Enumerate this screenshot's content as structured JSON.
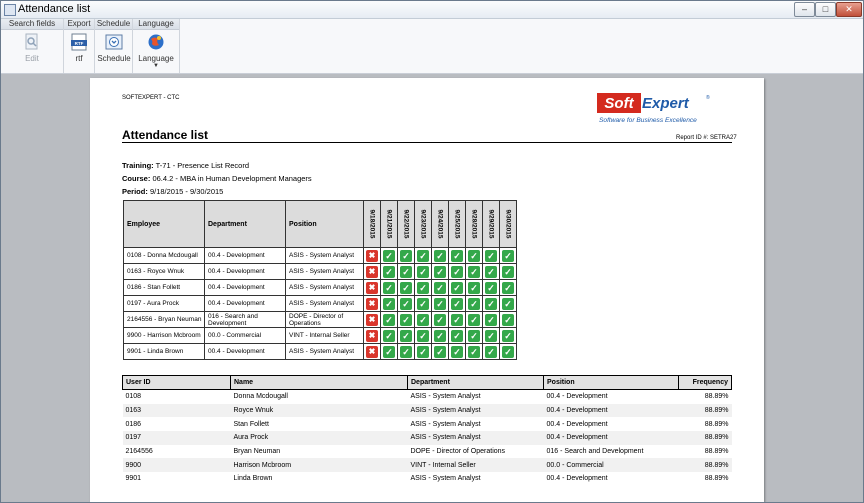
{
  "window": {
    "title": "Attendance list",
    "minimize": "–",
    "maximize": "□",
    "close": "✕"
  },
  "ribbon": {
    "groups": [
      {
        "name": "Search fields",
        "buttons": [
          {
            "label": "Edit",
            "icon": "magnifier-doc-icon",
            "disabled": true
          }
        ]
      },
      {
        "name": "Export",
        "buttons": [
          {
            "label": "rtf",
            "icon": "rtf-file-icon",
            "badge": "RTF"
          }
        ]
      },
      {
        "name": "Schedule",
        "buttons": [
          {
            "label": "Schedule",
            "icon": "schedule-icon"
          }
        ]
      },
      {
        "name": "Language",
        "buttons": [
          {
            "label": "Language",
            "icon": "globe-icon"
          }
        ]
      }
    ]
  },
  "report": {
    "company": "SOFTEXPERT - CTC",
    "logo": {
      "brand_left": "Soft",
      "brand_right": "Expert",
      "tagline": "Software for Business Excellence",
      "reg": "®"
    },
    "title": "Attendance list",
    "report_id": "Report ID #: SETRA27",
    "training_label": "Training:",
    "training": "T-71 - Presence List Record",
    "course_label": "Course:",
    "course": "06.4.2 - MBA in Human Development Managers",
    "period_label": "Period:",
    "period": "9/18/2015 - 9/30/2015",
    "attendance": {
      "headers": {
        "employee": "Employee",
        "department": "Department",
        "position": "Position"
      },
      "dates": [
        "9/18/2015",
        "9/21/2015",
        "9/22/2015",
        "9/23/2015",
        "9/24/2015",
        "9/25/2015",
        "9/28/2015",
        "9/29/2015",
        "9/30/2015"
      ],
      "rows": [
        {
          "employee": "0108 - Donna Mcdougall",
          "department": "00.4 - Development",
          "position": "ASIS - System Analyst",
          "marks": [
            false,
            true,
            true,
            true,
            true,
            true,
            true,
            true,
            true
          ]
        },
        {
          "employee": "0163 - Royce Wnuk",
          "department": "00.4 - Development",
          "position": "ASIS - System Analyst",
          "marks": [
            false,
            true,
            true,
            true,
            true,
            true,
            true,
            true,
            true
          ]
        },
        {
          "employee": "0186 - Stan Follett",
          "department": "00.4 - Development",
          "position": "ASIS - System Analyst",
          "marks": [
            false,
            true,
            true,
            true,
            true,
            true,
            true,
            true,
            true
          ]
        },
        {
          "employee": "0197 - Aura Prock",
          "department": "00.4 - Development",
          "position": "ASIS - System Analyst",
          "marks": [
            false,
            true,
            true,
            true,
            true,
            true,
            true,
            true,
            true
          ]
        },
        {
          "employee": "2164556 - Bryan Neuman",
          "department": "016 - Search and Development",
          "position": "DOPE - Director of Operations",
          "marks": [
            false,
            true,
            true,
            true,
            true,
            true,
            true,
            true,
            true
          ]
        },
        {
          "employee": "9900 - Harrison Mcbroom",
          "department": "00.0 - Commercial",
          "position": "VINT - Internal Seller",
          "marks": [
            false,
            true,
            true,
            true,
            true,
            true,
            true,
            true,
            true
          ]
        },
        {
          "employee": "9901 - Linda Brown",
          "department": "00.4 - Development",
          "position": "ASIS - System Analyst",
          "marks": [
            false,
            true,
            true,
            true,
            true,
            true,
            true,
            true,
            true
          ]
        }
      ]
    },
    "users": {
      "headers": {
        "user_id": "User ID",
        "name": "Name",
        "department": "Department",
        "position": "Position",
        "frequency": "Frequency"
      },
      "rows": [
        {
          "user_id": "0108",
          "name": "Donna Mcdougall",
          "department": "ASIS - System Analyst",
          "position": "00.4 - Development",
          "frequency": "88.89%"
        },
        {
          "user_id": "0163",
          "name": "Royce Wnuk",
          "department": "ASIS - System Analyst",
          "position": "00.4 - Development",
          "frequency": "88.89%"
        },
        {
          "user_id": "0186",
          "name": "Stan Follett",
          "department": "ASIS - System Analyst",
          "position": "00.4 - Development",
          "frequency": "88.89%"
        },
        {
          "user_id": "0197",
          "name": "Aura Prock",
          "department": "ASIS - System Analyst",
          "position": "00.4 - Development",
          "frequency": "88.89%"
        },
        {
          "user_id": "2164556",
          "name": "Bryan Neuman",
          "department": "DOPE - Director of Operations",
          "position": "016 - Search and Development",
          "frequency": "88.89%"
        },
        {
          "user_id": "9900",
          "name": "Harrison Mcbroom",
          "department": "VINT - Internal Seller",
          "position": "00.0 - Commercial",
          "frequency": "88.89%"
        },
        {
          "user_id": "9901",
          "name": "Linda Brown",
          "department": "ASIS - System Analyst",
          "position": "00.4 - Development",
          "frequency": "88.89%"
        }
      ]
    }
  },
  "colors": {
    "present": "#34a84a",
    "absent": "#d9362c",
    "brand_red": "#d42a1e",
    "brand_blue": "#1e5aa8"
  }
}
